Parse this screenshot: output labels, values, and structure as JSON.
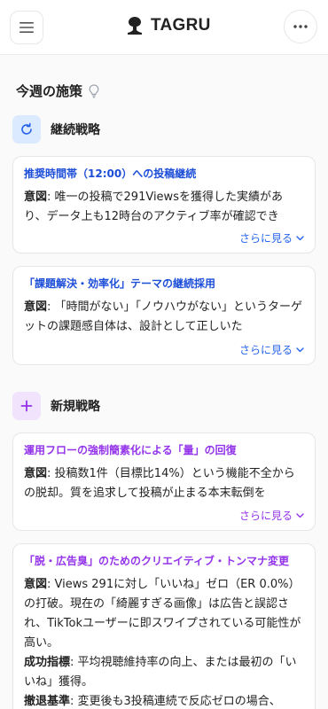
{
  "header": {
    "brand": "TAGRU",
    "menu_icon": "hamburger-icon",
    "more_icon": "ellipsis-icon",
    "logo_icon": "tree-logo-icon"
  },
  "section": {
    "title": "今週の施策",
    "icon": "lightbulb-icon"
  },
  "groups": [
    {
      "label": "継続戦略",
      "icon": "refresh-icon",
      "accent": "#2563eb",
      "cards": [
        {
          "title": "推奨時間帯（12:00）への投稿継続",
          "intent_label": "意図",
          "intent_text": ": 唯一の投稿で291Viewsを獲得した実績があり、データ上も12時台のアクティブ率が確認でき",
          "more_label": "さらに見る"
        },
        {
          "title": "「課題解決・効率化」テーマの継続採用",
          "intent_label": "意図",
          "intent_text": ": 「時間がない」「ノウハウがない」というターゲットの課題感自体は、設計として正しいた",
          "more_label": "さらに見る"
        }
      ]
    },
    {
      "label": "新規戦略",
      "icon": "plus-icon",
      "accent": "#9333ea",
      "cards": [
        {
          "title": "運用フローの強制簡素化による「量」の回復",
          "intent_label": "意図",
          "intent_text": ": 投稿数1件（目標比14%）という機能不全からの脱却。質を追求して投稿が止まる本末転倒を",
          "more_label": "さらに見る"
        },
        {
          "title": "「脱・広告臭」のためのクリエイティブ・トンマナ変更",
          "intent_label": "意図",
          "intent_text": ": Views 291に対し「いいね」ゼロ（ER 0.0%）の打破。現在の「綺麗すぎる画像」は広告と誤認され、TikTokユーザーに即スワイプされている可能性が高い。",
          "success_label": "成功指標",
          "success_text": ": 平均視聴維持率の向上、または最初の「いいね」獲得。",
          "withdraw_label": "撤退基準",
          "withdraw_text": ": 変更後も3投稿連続で反応ゼロの場合、"
        }
      ]
    }
  ]
}
